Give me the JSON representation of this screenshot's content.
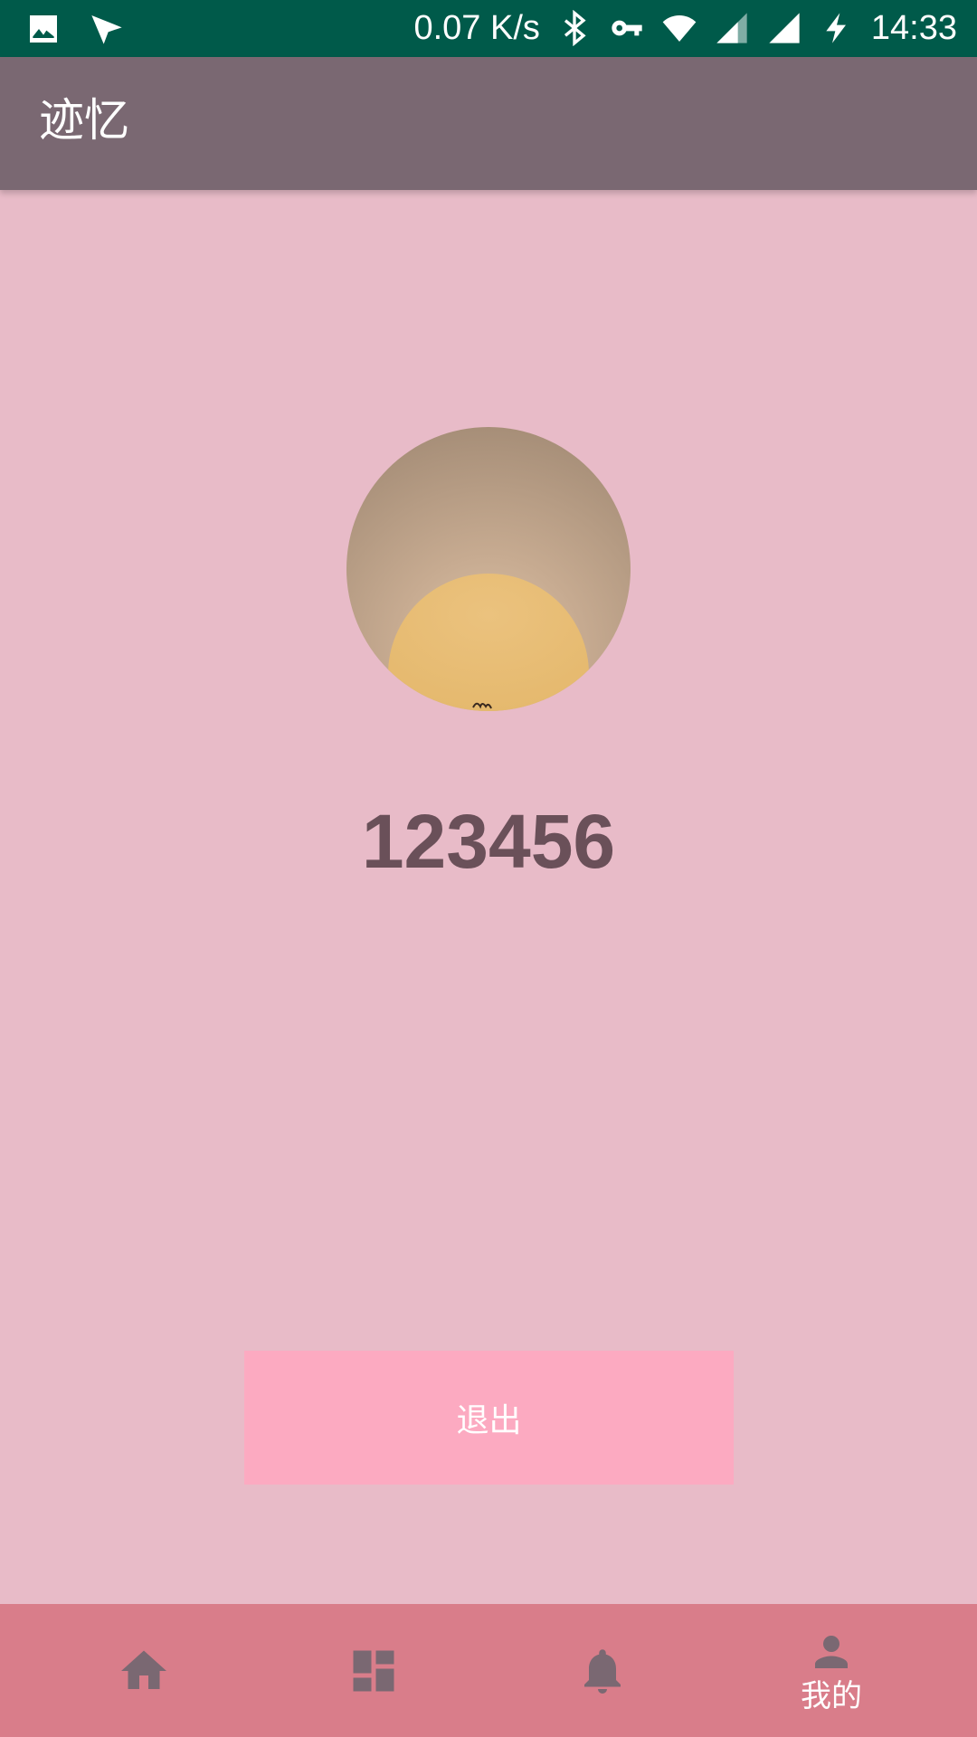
{
  "status_bar": {
    "network_speed": "0.07 K/s",
    "time": "14:33",
    "icons": [
      "image-icon",
      "send-icon",
      "bluetooth-icon",
      "vpn-key-icon",
      "wifi-icon",
      "signal-icon",
      "signal-icon",
      "charging-icon"
    ]
  },
  "app_bar": {
    "title": "迹忆"
  },
  "profile": {
    "username": "123456"
  },
  "actions": {
    "logout_label": "退出"
  },
  "bottom_nav": {
    "items": [
      {
        "icon": "home-icon",
        "label": ""
      },
      {
        "icon": "dashboard-icon",
        "label": ""
      },
      {
        "icon": "bell-icon",
        "label": ""
      },
      {
        "icon": "person-icon",
        "label": "我的"
      }
    ],
    "active_index": 3
  },
  "colors": {
    "status_bar": "#005a4a",
    "app_bar": "#7a6872",
    "background": "#e8bbc8",
    "button": "#fcaac1",
    "bottom_nav": "#d97d8a",
    "nav_icon_inactive": "#7a6872"
  }
}
